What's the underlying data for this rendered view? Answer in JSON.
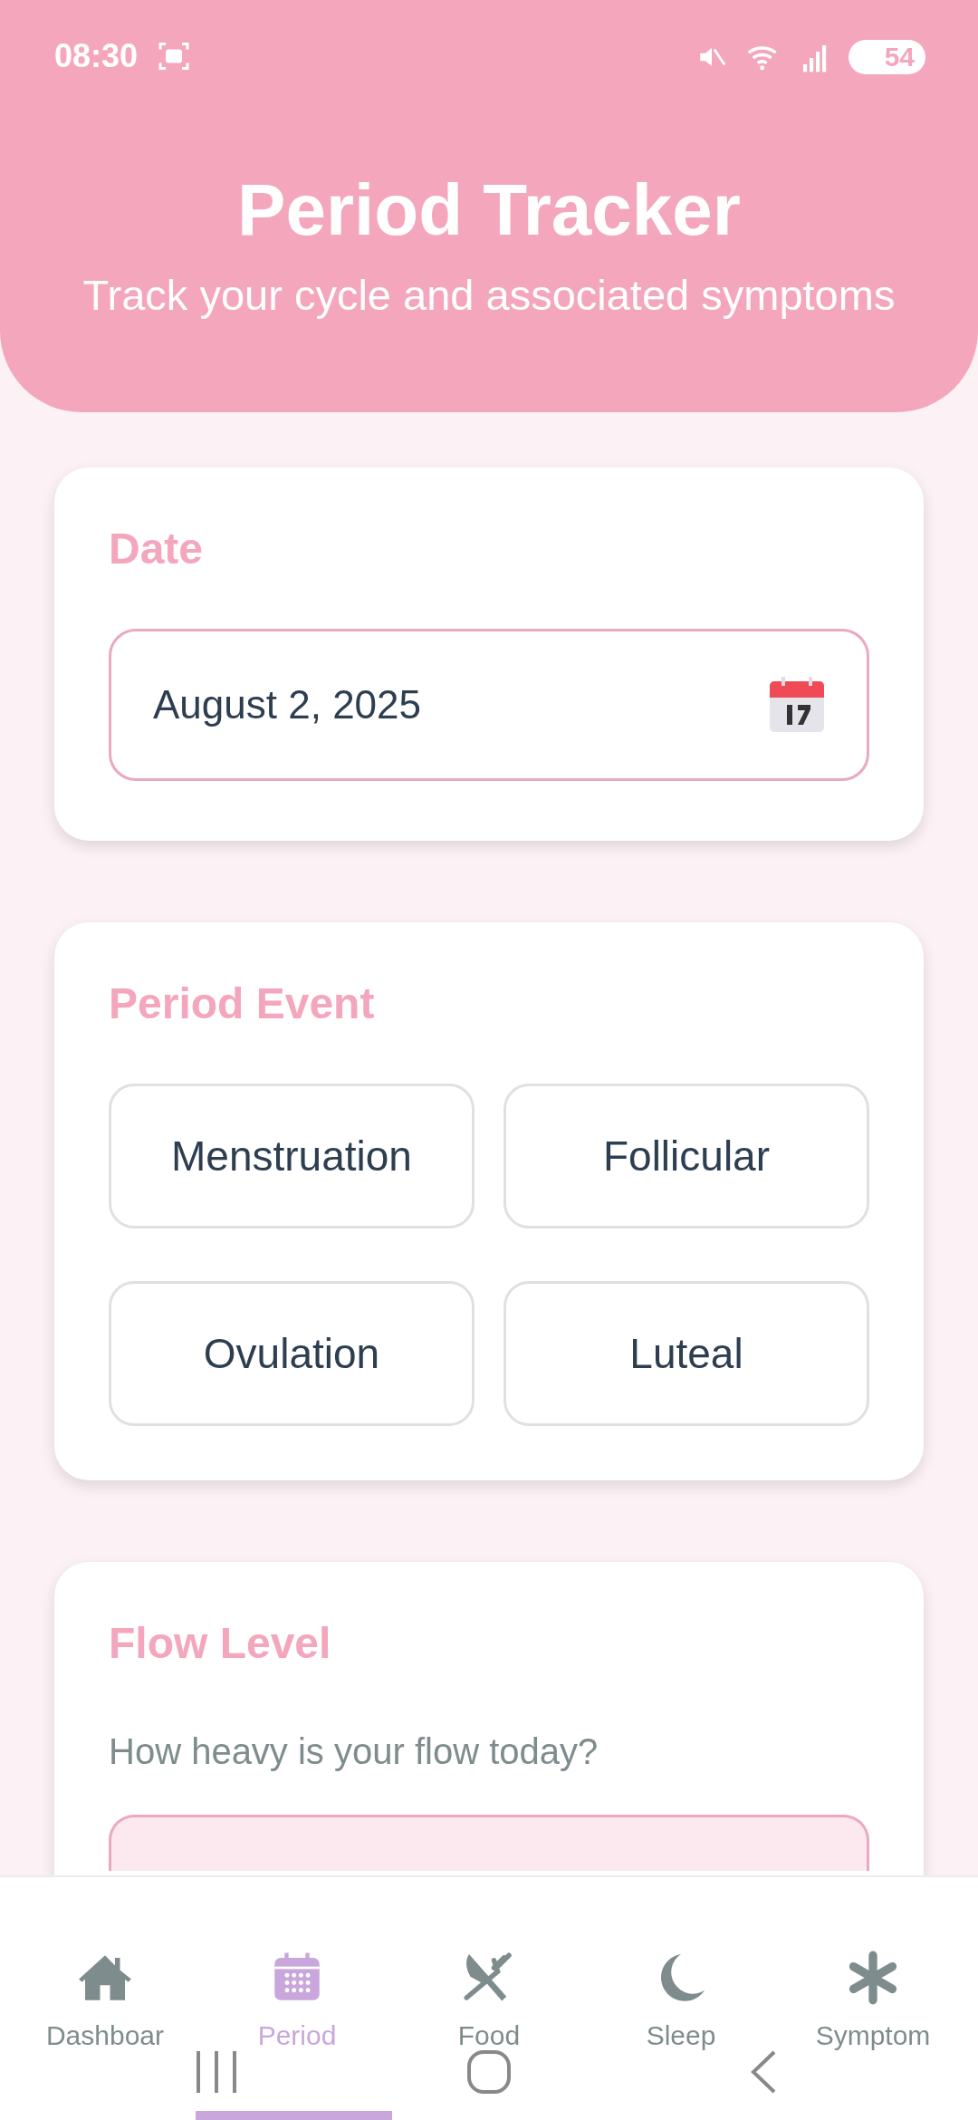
{
  "status_bar": {
    "time": "08:30",
    "battery": "54"
  },
  "header": {
    "title": "Period Tracker",
    "subtitle": "Track your cycle and associated symptoms"
  },
  "date_section": {
    "label": "Date",
    "value": "August 2, 2025"
  },
  "event_section": {
    "label": "Period Event",
    "options": [
      {
        "label": "Menstruation",
        "selected": false
      },
      {
        "label": "Follicular",
        "selected": false
      },
      {
        "label": "Ovulation",
        "selected": false
      },
      {
        "label": "Luteal",
        "selected": false
      }
    ]
  },
  "flow_section": {
    "label": "Flow Level",
    "question": "How heavy is your flow today?",
    "options": [
      {
        "selected": true
      }
    ]
  },
  "bottom_nav": [
    {
      "label": "Dashboar",
      "selected": false
    },
    {
      "label": "Period",
      "selected": true
    },
    {
      "label": "Food",
      "selected": false
    },
    {
      "label": "Sleep",
      "selected": false
    },
    {
      "label": "Symptom",
      "selected": false
    }
  ]
}
